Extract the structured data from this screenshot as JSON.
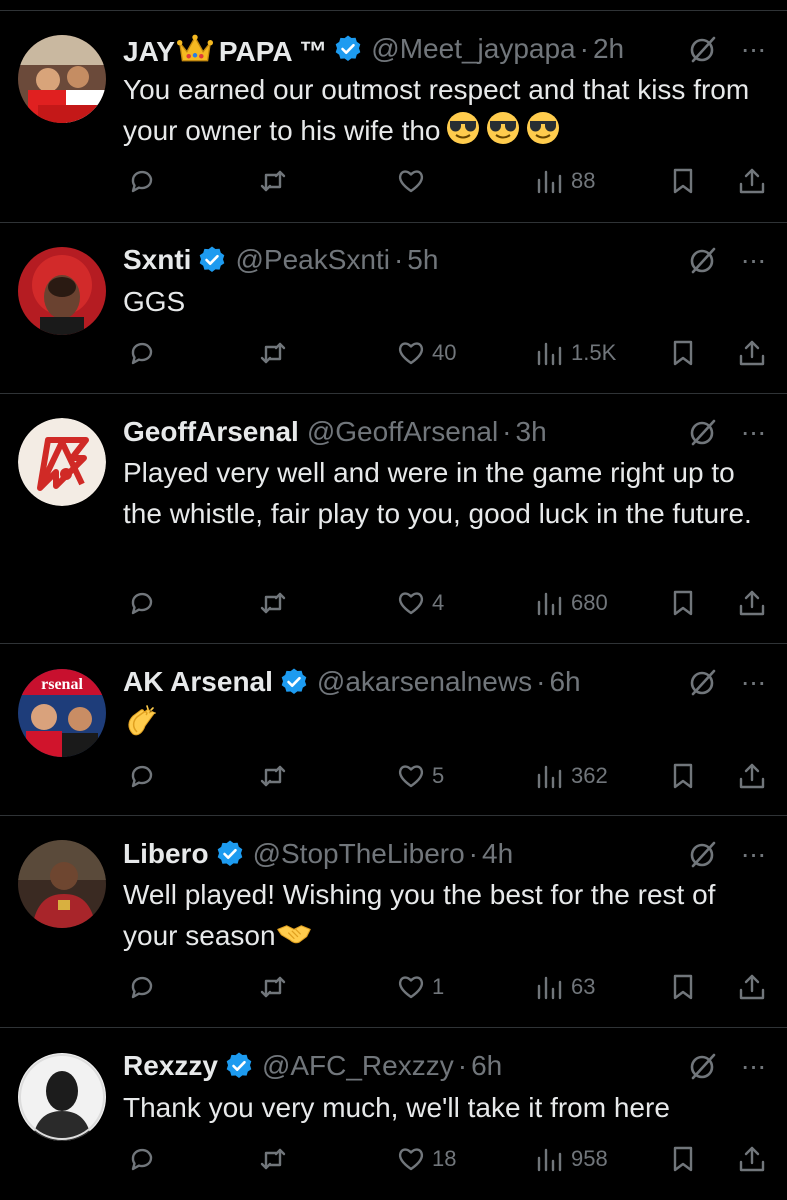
{
  "colors": {
    "background": "#000000",
    "text": "#e7e9ea",
    "muted": "#71767b",
    "verified": "#1d9bf0",
    "divider": "#2f3336"
  },
  "icons": {
    "reply": "reply-bubble-icon",
    "retweet": "retweet-icon",
    "like": "heart-icon",
    "views": "views-bars-icon",
    "bookmark": "bookmark-icon",
    "share": "share-icon",
    "grok": "grok-slash-icon",
    "more": "more-dots-icon",
    "verified": "verified-badge-icon"
  },
  "tweets": [
    {
      "name_pre": "JAY",
      "name_post": "PAPA ™",
      "name_emoji": "crown",
      "handle": "@Meet_jaypapa",
      "separator": "·",
      "time": "2h",
      "text": "You earned our outmost respect and that kiss from your owner to his wife tho",
      "text_emojis": [
        "sunglasses",
        "sunglasses",
        "sunglasses"
      ],
      "likes": "",
      "views": "88",
      "more": "···"
    },
    {
      "name": "Sxnti",
      "handle": "@PeakSxnti",
      "separator": "·",
      "time": "5h",
      "text": "GGS",
      "likes": "40",
      "views": "1.5K",
      "more": "···"
    },
    {
      "name": "GeoffArsenal",
      "handle": "@GeoffArsenal",
      "separator": "·",
      "time": "3h",
      "text": "Played very well and were in the game right up to the whistle, fair play to you, good luck in the future.",
      "likes": "4",
      "views": "680",
      "more": "···"
    },
    {
      "name": "AK Arsenal",
      "handle": "@akarsenalnews",
      "separator": "·",
      "time": "6h",
      "text": "",
      "text_emojis": [
        "clapping-hands"
      ],
      "avatar_text": "rsenal",
      "likes": "5",
      "views": "362",
      "more": "···"
    },
    {
      "name": "Libero",
      "handle": "@StopTheLibero",
      "separator": "·",
      "time": "4h",
      "text": "Well played! Wishing you the best for the rest of your season",
      "text_emojis": [
        "handshake"
      ],
      "likes": "1",
      "views": "63",
      "more": "···"
    },
    {
      "name": "Rexzzy",
      "handle": "@AFC_Rexzzy",
      "separator": "·",
      "time": "6h",
      "text": "Thank you very much, we'll take it from here",
      "likes": "18",
      "views": "958",
      "more": "···"
    }
  ]
}
